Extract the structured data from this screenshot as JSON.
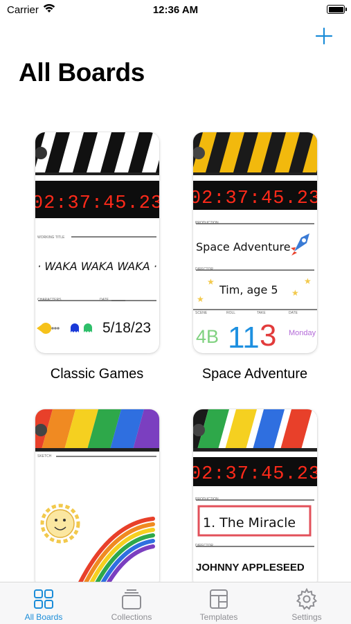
{
  "status_bar": {
    "carrier": "Carrier",
    "time": "12:36 AM"
  },
  "header": {
    "title": "All Boards",
    "add_icon": "plus-icon"
  },
  "boards": [
    {
      "title": "Classic Games",
      "timecode": "02:37:45.23",
      "fields": {
        "working_title_label": "WORKING TITLE",
        "working_title": "· WAKA WAKA WAKA ·",
        "characters_label": "CHARACTERS",
        "date_label": "DATE",
        "date": "5/18/23"
      }
    },
    {
      "title": "Space Adventure",
      "timecode": "02:37:45.23",
      "fields": {
        "production_label": "PRODUCTION",
        "production": "Space Adventure",
        "director_label": "DIRECTOR",
        "director": "Tim, age 5",
        "scene_label": "SCENE",
        "scene": "4B",
        "roll_label": "ROLL",
        "roll": "11",
        "take_label": "TAKE",
        "take": "3",
        "date_label": "DATE",
        "date": "Monday"
      }
    },
    {
      "title": "",
      "fields": {
        "sketch_label": "SKETCH"
      }
    },
    {
      "title": "",
      "timecode": "02:37:45.23",
      "fields": {
        "production_label": "PRODUCTION",
        "production": "1. The Miracle",
        "director_label": "DIRECTOR",
        "director": "JOHNNY APPLESEED"
      }
    }
  ],
  "tabs": [
    {
      "label": "All Boards",
      "icon": "grid-icon",
      "active": true
    },
    {
      "label": "Collections",
      "icon": "stack-icon",
      "active": false
    },
    {
      "label": "Templates",
      "icon": "template-icon",
      "active": false
    },
    {
      "label": "Settings",
      "icon": "gear-icon",
      "active": false
    }
  ],
  "colors": {
    "accent": "#1a8cd8",
    "timecode": "#ff2a1a",
    "inactive_tab": "#8e8e93"
  }
}
